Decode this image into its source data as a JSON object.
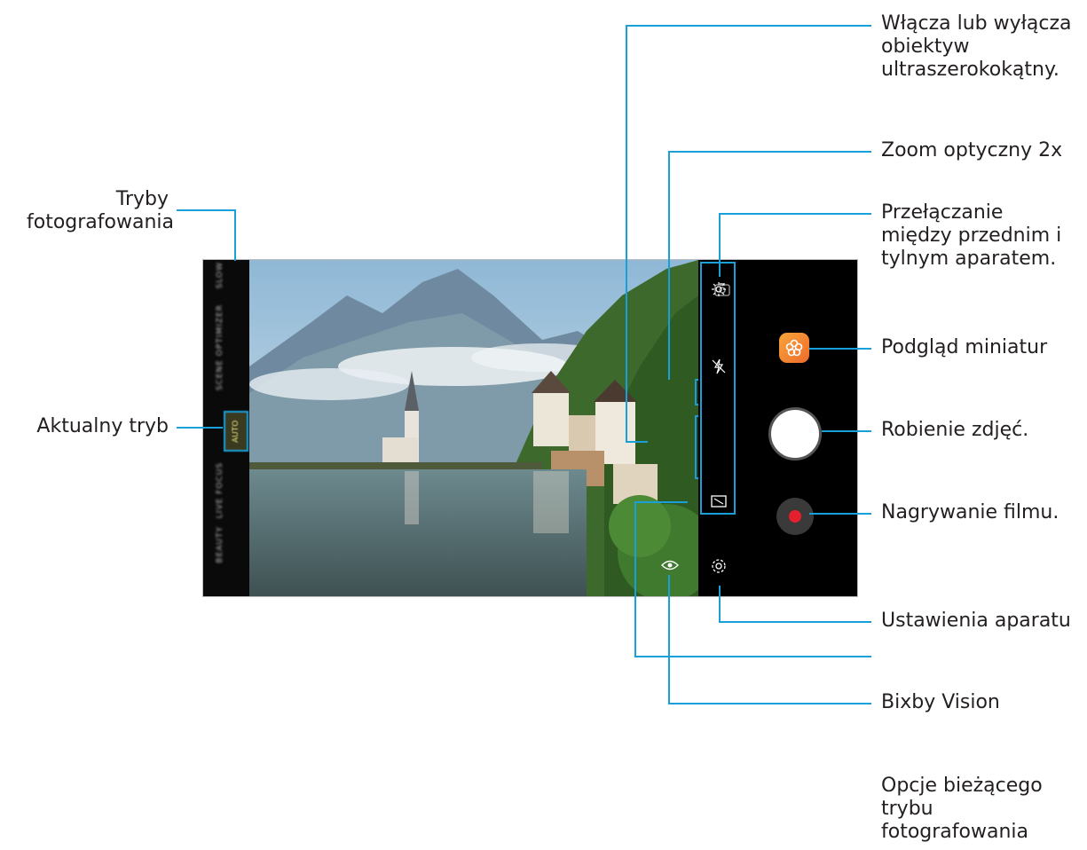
{
  "annotations": {
    "modes_l1": "Tryby",
    "modes_l2": "fotografowania",
    "current_mode": "Aktualny tryb",
    "wide_l1": "Włącza lub wyłącza",
    "wide_l2": "obiektyw",
    "wide_l3": "ultraszerokokątny.",
    "zoom": "Zoom optyczny 2x",
    "switch_l1": "Przełączanie",
    "switch_l2": "między przednim i",
    "switch_l3": "tylnym aparatem.",
    "preview": "Podgląd miniatur",
    "take_photo": "Robienie zdjęć.",
    "record": "Nagrywanie filmu.",
    "settings": "Ustawienia aparatu",
    "bixby": "Bixby Vision",
    "options_l1": "Opcje bieżącego",
    "options_l2": "trybu",
    "options_l3": "fotografowania"
  },
  "screen": {
    "modes": [
      "BEAUTY",
      "LIVE FOCUS",
      "AUTO",
      "SCENE OPTIMIZER",
      "SLOW"
    ],
    "current_mode": "AUTO"
  },
  "colors": {
    "callout_line": "#1aa0d8",
    "record_dot": "#e5202e",
    "thumbnail": "#f38a33"
  },
  "icons": {
    "switch_camera": "switch-camera-icon",
    "thumbnail": "gallery-flower-icon",
    "settings": "gear-icon",
    "bixby": "eye-icon",
    "zoom": "tree-icon",
    "wide": "wide-trees-icon",
    "hdr": "sun-icon",
    "flash": "flash-off-icon",
    "ratio": "aspect-ratio-icon"
  }
}
